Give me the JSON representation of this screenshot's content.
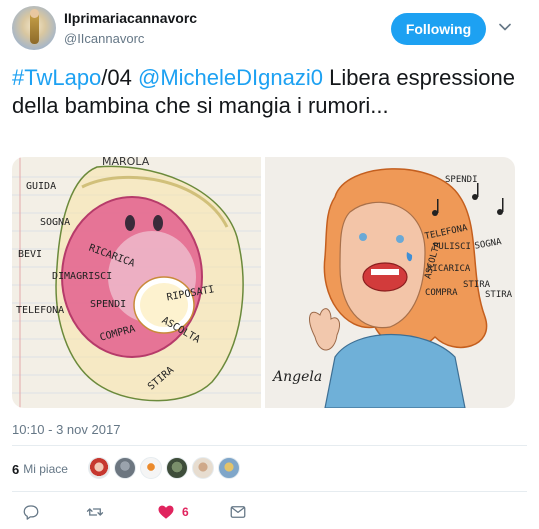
{
  "user": {
    "display_name": "IIprimariacannavorc",
    "screen_name": "@IIcannavorc"
  },
  "follow_button": {
    "label": "Following"
  },
  "tweet": {
    "hashtag": "#TwLapo",
    "text_after_hashtag": "/04 ",
    "mention": "@MicheleDIgnazi0",
    "text": " Libera espressione della bambina che si mangia i rumori...",
    "timestamp": "10:10 - 3 nov 2017"
  },
  "photo_1": {
    "words": [
      "GUIDA",
      "SOGNA",
      "BEVI",
      "RICARICA",
      "DIMAGRISCI",
      "TELEFONA",
      "SPENDI",
      "RIPOSATI",
      "COMPRA",
      "ASCOLTA",
      "STIRA"
    ]
  },
  "photo_2": {
    "words": [
      "SPENDI",
      "TELEFONA",
      "ASCOLTA",
      "PULISCI",
      "SOGNA",
      "RICARICA",
      "STIRA",
      "COMPRA",
      "STIRA"
    ],
    "signature": "Angela"
  },
  "likes": {
    "count": "6",
    "label": "Mi piace"
  },
  "actions": {
    "like_count": "6"
  },
  "colors": {
    "accent": "#1da1f2",
    "like": "#e0245e",
    "secondary_text": "#657786"
  }
}
